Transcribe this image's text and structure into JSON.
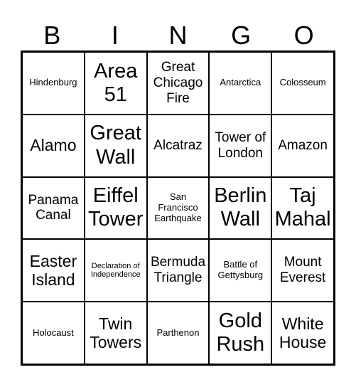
{
  "header": [
    "B",
    "I",
    "N",
    "G",
    "O"
  ],
  "cells": [
    {
      "text": "Hindenburg",
      "size": "s-sm"
    },
    {
      "text": "Area 51",
      "size": "s-xl"
    },
    {
      "text": "Great Chicago Fire",
      "size": "s-md"
    },
    {
      "text": "Antarctica",
      "size": "s-sm"
    },
    {
      "text": "Colosseum",
      "size": "s-sm"
    },
    {
      "text": "Alamo",
      "size": "s-lg"
    },
    {
      "text": "Great Wall",
      "size": "s-xl"
    },
    {
      "text": "Alcatraz",
      "size": "s-md"
    },
    {
      "text": "Tower of London",
      "size": "s-md"
    },
    {
      "text": "Amazon",
      "size": "s-md"
    },
    {
      "text": "Panama Canal",
      "size": "s-md"
    },
    {
      "text": "Eiffel Tower",
      "size": "s-xl"
    },
    {
      "text": "San Francisco Earthquake",
      "size": "s-sm"
    },
    {
      "text": "Berlin Wall",
      "size": "s-xl"
    },
    {
      "text": "Taj Mahal",
      "size": "s-xl"
    },
    {
      "text": "Easter Island",
      "size": "s-lg"
    },
    {
      "text": "Declaration of Independence",
      "size": "s-xs"
    },
    {
      "text": "Bermuda Triangle",
      "size": "s-md"
    },
    {
      "text": "Battle of Gettysburg",
      "size": "s-sm"
    },
    {
      "text": "Mount Everest",
      "size": "s-md"
    },
    {
      "text": "Holocaust",
      "size": "s-sm"
    },
    {
      "text": "Twin Towers",
      "size": "s-lg"
    },
    {
      "text": "Parthenon",
      "size": "s-sm"
    },
    {
      "text": "Gold Rush",
      "size": "s-xl"
    },
    {
      "text": "White House",
      "size": "s-lg"
    }
  ]
}
